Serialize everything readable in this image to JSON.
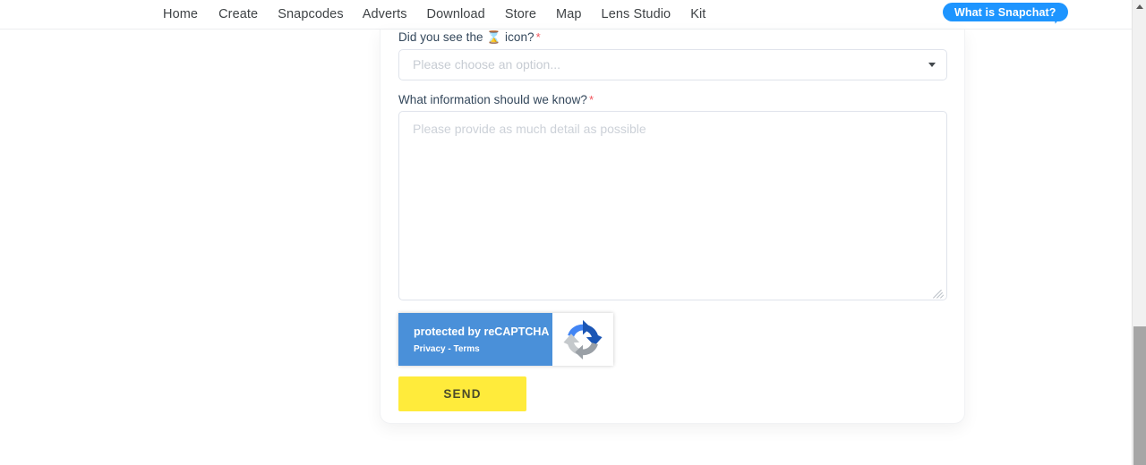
{
  "nav": {
    "links": [
      {
        "label": "Home"
      },
      {
        "label": "Create"
      },
      {
        "label": "Snapcodes"
      },
      {
        "label": "Adverts"
      },
      {
        "label": "Download"
      },
      {
        "label": "Store"
      },
      {
        "label": "Map"
      },
      {
        "label": "Lens Studio"
      },
      {
        "label": "Kit"
      }
    ],
    "cta_label": "What is Snapchat?",
    "cta_color": "#1e95ff"
  },
  "form": {
    "field_select": {
      "label_prefix": "Did you see the",
      "label_icon": "⌛",
      "label_suffix": "icon?",
      "required_marker": "*",
      "placeholder": "Please choose an option...",
      "value": ""
    },
    "field_textarea": {
      "label": "What information should we know?",
      "required_marker": "*",
      "placeholder": "Please provide as much detail as possible",
      "value": ""
    },
    "recaptcha": {
      "title": "protected by reCAPTCHA",
      "links": "Privacy - Terms",
      "badge_color": "#4a90d9"
    },
    "submit_label": "SEND",
    "submit_color": "#ffeb3b"
  }
}
